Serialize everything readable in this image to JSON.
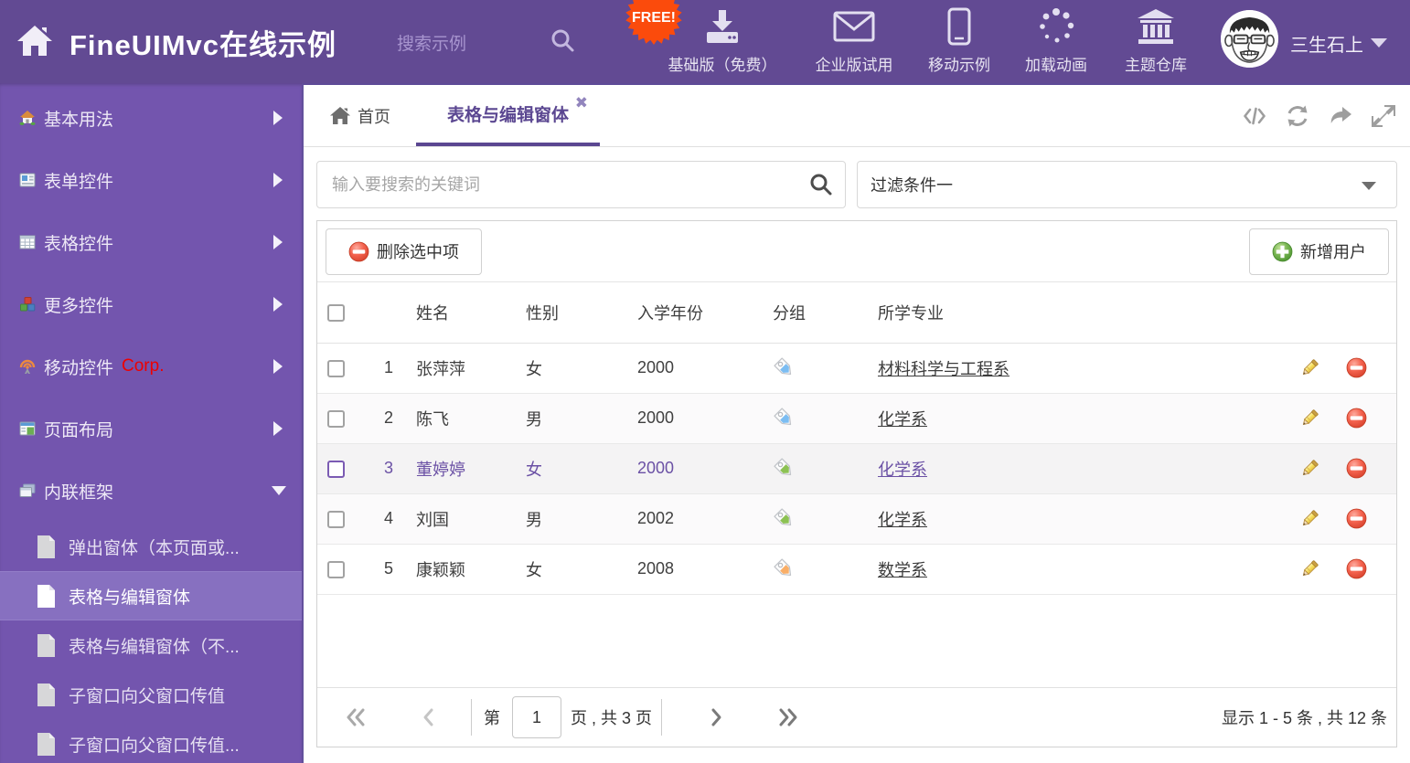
{
  "header": {
    "title": "FineUIMvc在线示例",
    "search_placeholder": "搜索示例",
    "free_badge": "FREE!",
    "nav": [
      {
        "icon": "download-icon",
        "label": "基础版（免费）"
      },
      {
        "icon": "envelope-icon",
        "label": "企业版试用"
      },
      {
        "icon": "phone-icon",
        "label": "移动示例"
      },
      {
        "icon": "spinner-icon",
        "label": "加载动画"
      },
      {
        "icon": "bank-icon",
        "label": "主题仓库"
      }
    ],
    "user": {
      "name": "三生石上"
    }
  },
  "sidebar": {
    "items": [
      {
        "label": "基本用法"
      },
      {
        "label": "表单控件"
      },
      {
        "label": "表格控件"
      },
      {
        "label": "更多控件"
      },
      {
        "label": "移动控件",
        "badge": "Corp."
      },
      {
        "label": "页面布局"
      },
      {
        "label": "内联框架"
      }
    ],
    "submenu": [
      {
        "label": "弹出窗体（本页面或..."
      },
      {
        "label": "表格与编辑窗体"
      },
      {
        "label": "表格与编辑窗体（不..."
      },
      {
        "label": "子窗口向父窗口传值"
      },
      {
        "label": "子窗口向父窗口传值..."
      }
    ]
  },
  "tabs": {
    "home": "首页",
    "active": "表格与编辑窗体"
  },
  "filter": {
    "search_placeholder": "输入要搜索的关键词",
    "dropdown_value": "过滤条件一"
  },
  "toolbar": {
    "delete_label": "删除选中项",
    "add_label": "新增用户"
  },
  "table": {
    "headers": {
      "name": "姓名",
      "gender": "性别",
      "year": "入学年份",
      "group": "分组",
      "major": "所学专业"
    },
    "rows": [
      {
        "index": "1",
        "name": "张萍萍",
        "gender": "女",
        "year": "2000",
        "tag": "blue",
        "major": "材料科学与工程系"
      },
      {
        "index": "2",
        "name": "陈飞",
        "gender": "男",
        "year": "2000",
        "tag": "blue",
        "major": "化学系"
      },
      {
        "index": "3",
        "name": "董婷婷",
        "gender": "女",
        "year": "2000",
        "tag": "green",
        "major": "化学系"
      },
      {
        "index": "4",
        "name": "刘国",
        "gender": "男",
        "year": "2002",
        "tag": "green",
        "major": "化学系"
      },
      {
        "index": "5",
        "name": "康颖颖",
        "gender": "女",
        "year": "2008",
        "tag": "orange",
        "major": "数学系"
      }
    ]
  },
  "pagination": {
    "prefix": "第",
    "page": "1",
    "suffix": "页 , 共 3 页",
    "summary": "显示 1 - 5 条 , 共 12 条"
  },
  "colors": {
    "header_bg": "#624a93",
    "sidebar_bg": "#7355ae",
    "accent_purple": "#5b4791",
    "free_badge": "#fb4b0c",
    "tag_blue": "#7cbdf2",
    "tag_green": "#8cc153",
    "tag_orange": "#f9ae67"
  }
}
